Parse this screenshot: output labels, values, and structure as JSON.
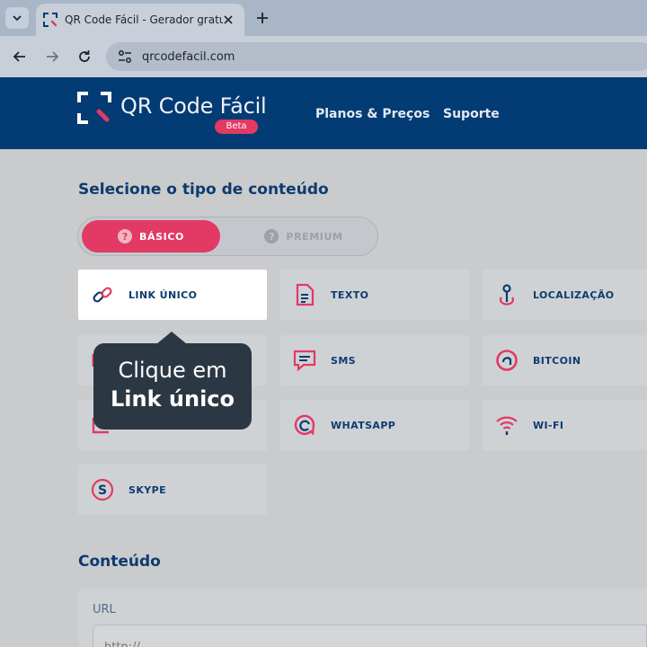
{
  "browser": {
    "tab_title": "QR Code Fácil - Gerador gratuito",
    "url": "qrcodefacil.com"
  },
  "header": {
    "logo_text": "QR Code Fácil",
    "badge": "Beta",
    "nav": [
      "Planos & Preços",
      "Suporte"
    ]
  },
  "content_type": {
    "title": "Selecione o tipo de conteúdo",
    "toggle": {
      "active": "BÁSICO",
      "inactive": "PREMIUM"
    },
    "items": [
      {
        "label": "LINK ÚNICO",
        "icon": "link-icon",
        "selected": true
      },
      {
        "label": "TEXTO",
        "icon": "text-document-icon"
      },
      {
        "label": "LOCALIZAÇÃO",
        "icon": "location-pin-icon"
      },
      {
        "label": "SMS",
        "icon": "sms-icon"
      },
      {
        "label": "BITCOIN",
        "icon": "bitcoin-icon"
      },
      {
        "label": "WHATSAPP",
        "icon": "whatsapp-icon"
      },
      {
        "label": "WI-FI",
        "icon": "wifi-icon"
      },
      {
        "label": "SKYPE",
        "icon": "skype-icon"
      }
    ]
  },
  "tooltip": {
    "line1": "Clique em",
    "line2": "Link único"
  },
  "content": {
    "title": "Conteúdo",
    "url_label": "URL",
    "url_placeholder": "http://"
  },
  "colors": {
    "brand": "#033b74",
    "accent": "#e23a64"
  }
}
